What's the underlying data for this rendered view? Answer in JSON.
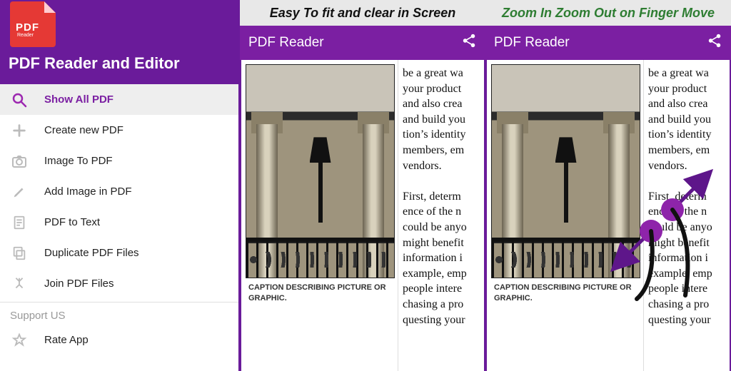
{
  "panel1": {
    "logo_text": "PDF",
    "logo_sub": "Reader",
    "title": "PDF Reader and Editor",
    "menu": [
      {
        "icon": "search",
        "label": "Show All PDF",
        "selected": true
      },
      {
        "icon": "plus",
        "label": "Create new PDF",
        "selected": false
      },
      {
        "icon": "camera",
        "label": "Image To PDF",
        "selected": false
      },
      {
        "icon": "pen",
        "label": "Add Image in PDF",
        "selected": false
      },
      {
        "icon": "doc",
        "label": "PDF to Text",
        "selected": false
      },
      {
        "icon": "copy",
        "label": "Duplicate PDF Files",
        "selected": false
      },
      {
        "icon": "merge",
        "label": "Join PDF Files",
        "selected": false
      }
    ],
    "section_label": "Support US",
    "menu2": [
      {
        "icon": "star",
        "label": "Rate App",
        "selected": false
      }
    ]
  },
  "panel2": {
    "caption": "Easy To fit and clear in Screen",
    "bar_title": "PDF Reader",
    "pic_caption": "Caption describing picture or graphic.",
    "body_text": "be a great wa\nyour product\nand also crea\nand build you\ntion’s identity\nmembers, em\nvendors.\n\nFirst, determ\nence of the n\ncould be anyo\nmight benefit\ninformation i\nexample, emp\npeople intere\nchasing a pro\nquesting your"
  },
  "panel3": {
    "caption": "Zoom In Zoom Out on Finger Move",
    "bar_title": "PDF Reader",
    "pic_caption": "Caption describing picture or graphic.",
    "body_text": "be a great wa\nyour product\nand also crea\nand build you\ntion’s identity\nmembers, em\nvendors.\n\nFirst, determ\nence of the n\ncould be anyo\nmight benefit\ninformation i\nexample, emp\npeople intere\nchasing a pro\nquesting your"
  },
  "colors": {
    "accent": "#7b1fa2",
    "header": "#6a1b9a"
  }
}
